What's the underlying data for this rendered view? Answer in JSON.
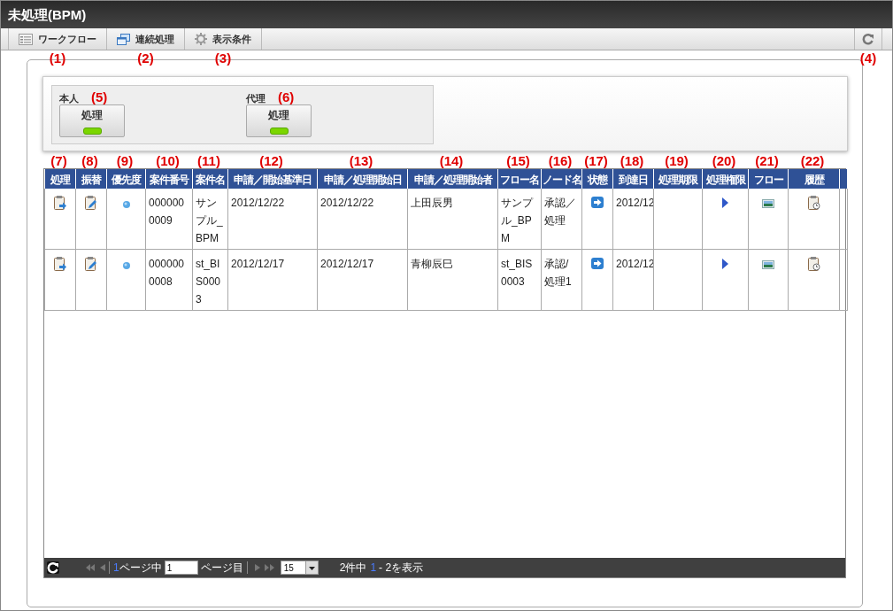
{
  "window": {
    "title": "未処理(BPM)"
  },
  "toolbar": {
    "buttons": [
      {
        "label": "ワークフロー",
        "callout": "(1)"
      },
      {
        "label": "連続処理",
        "callout": "(2)"
      },
      {
        "label": "表示条件",
        "callout": "(3)"
      }
    ],
    "refresh": {
      "callout": "(4)"
    }
  },
  "groups": [
    {
      "label": "本人",
      "callout": "(5)",
      "button": "処理",
      "lit": true
    },
    {
      "label": "代理",
      "callout": "(6)",
      "button": "処理",
      "lit": true
    }
  ],
  "table": {
    "columns": [
      {
        "label": "処理",
        "callout": "(7)"
      },
      {
        "label": "振替",
        "callout": "(8)"
      },
      {
        "label": "優先度",
        "callout": "(9)"
      },
      {
        "label": "案件番号",
        "callout": "(10)"
      },
      {
        "label": "案件名",
        "callout": "(11)"
      },
      {
        "label": "申請／開始基準日",
        "callout": "(12)"
      },
      {
        "label": "申請／処理開始日",
        "callout": "(13)"
      },
      {
        "label": "申請／処理開始者",
        "callout": "(14)"
      },
      {
        "label": "フロー名",
        "callout": "(15)"
      },
      {
        "label": "ノード名",
        "callout": "(16)"
      },
      {
        "label": "状態",
        "callout": "(17)"
      },
      {
        "label": "到達日",
        "callout": "(18)"
      },
      {
        "label": "処理期限",
        "callout": "(19)"
      },
      {
        "label": "処理権限",
        "callout": "(20)"
      },
      {
        "label": "フロー",
        "callout": "(21)"
      },
      {
        "label": "履歴",
        "callout": "(22)"
      }
    ],
    "rows": [
      {
        "cells": [
          {
            "kind": "process"
          },
          {
            "kind": "transfer"
          },
          {
            "kind": "priority"
          },
          {
            "kind": "text",
            "text": "0000000009"
          },
          {
            "kind": "text",
            "text": "サンプル_BPM"
          },
          {
            "kind": "text",
            "text": "2012/12/22"
          },
          {
            "kind": "text",
            "text": "2012/12/22"
          },
          {
            "kind": "text",
            "text": "上田辰男"
          },
          {
            "kind": "text",
            "text": "サンプル_BPM"
          },
          {
            "kind": "text",
            "text": "承認／処理"
          },
          {
            "kind": "status"
          },
          {
            "kind": "text",
            "text": "2012/12"
          },
          {
            "kind": "blank"
          },
          {
            "kind": "play"
          },
          {
            "kind": "flow"
          },
          {
            "kind": "history"
          }
        ]
      },
      {
        "cells": [
          {
            "kind": "process"
          },
          {
            "kind": "transfer"
          },
          {
            "kind": "priority"
          },
          {
            "kind": "text",
            "text": "0000000008"
          },
          {
            "kind": "text",
            "text": "st_BIS0003"
          },
          {
            "kind": "text",
            "text": "2012/12/17"
          },
          {
            "kind": "text",
            "text": "2012/12/17"
          },
          {
            "kind": "text",
            "text": "青柳辰巳"
          },
          {
            "kind": "text",
            "text": "st_BIS0003"
          },
          {
            "kind": "text",
            "text": "承認/処理1"
          },
          {
            "kind": "status"
          },
          {
            "kind": "text",
            "text": "2012/12"
          },
          {
            "kind": "blank"
          },
          {
            "kind": "play"
          },
          {
            "kind": "flow"
          },
          {
            "kind": "history"
          }
        ]
      }
    ]
  },
  "pager": {
    "page": "1",
    "page_of": "ページ中",
    "page_input": "1",
    "page_suffix": "ページ目",
    "page_size": "15",
    "summary_total": "2件中",
    "summary_from": "1",
    "summary_rest": "- 2を表示"
  }
}
